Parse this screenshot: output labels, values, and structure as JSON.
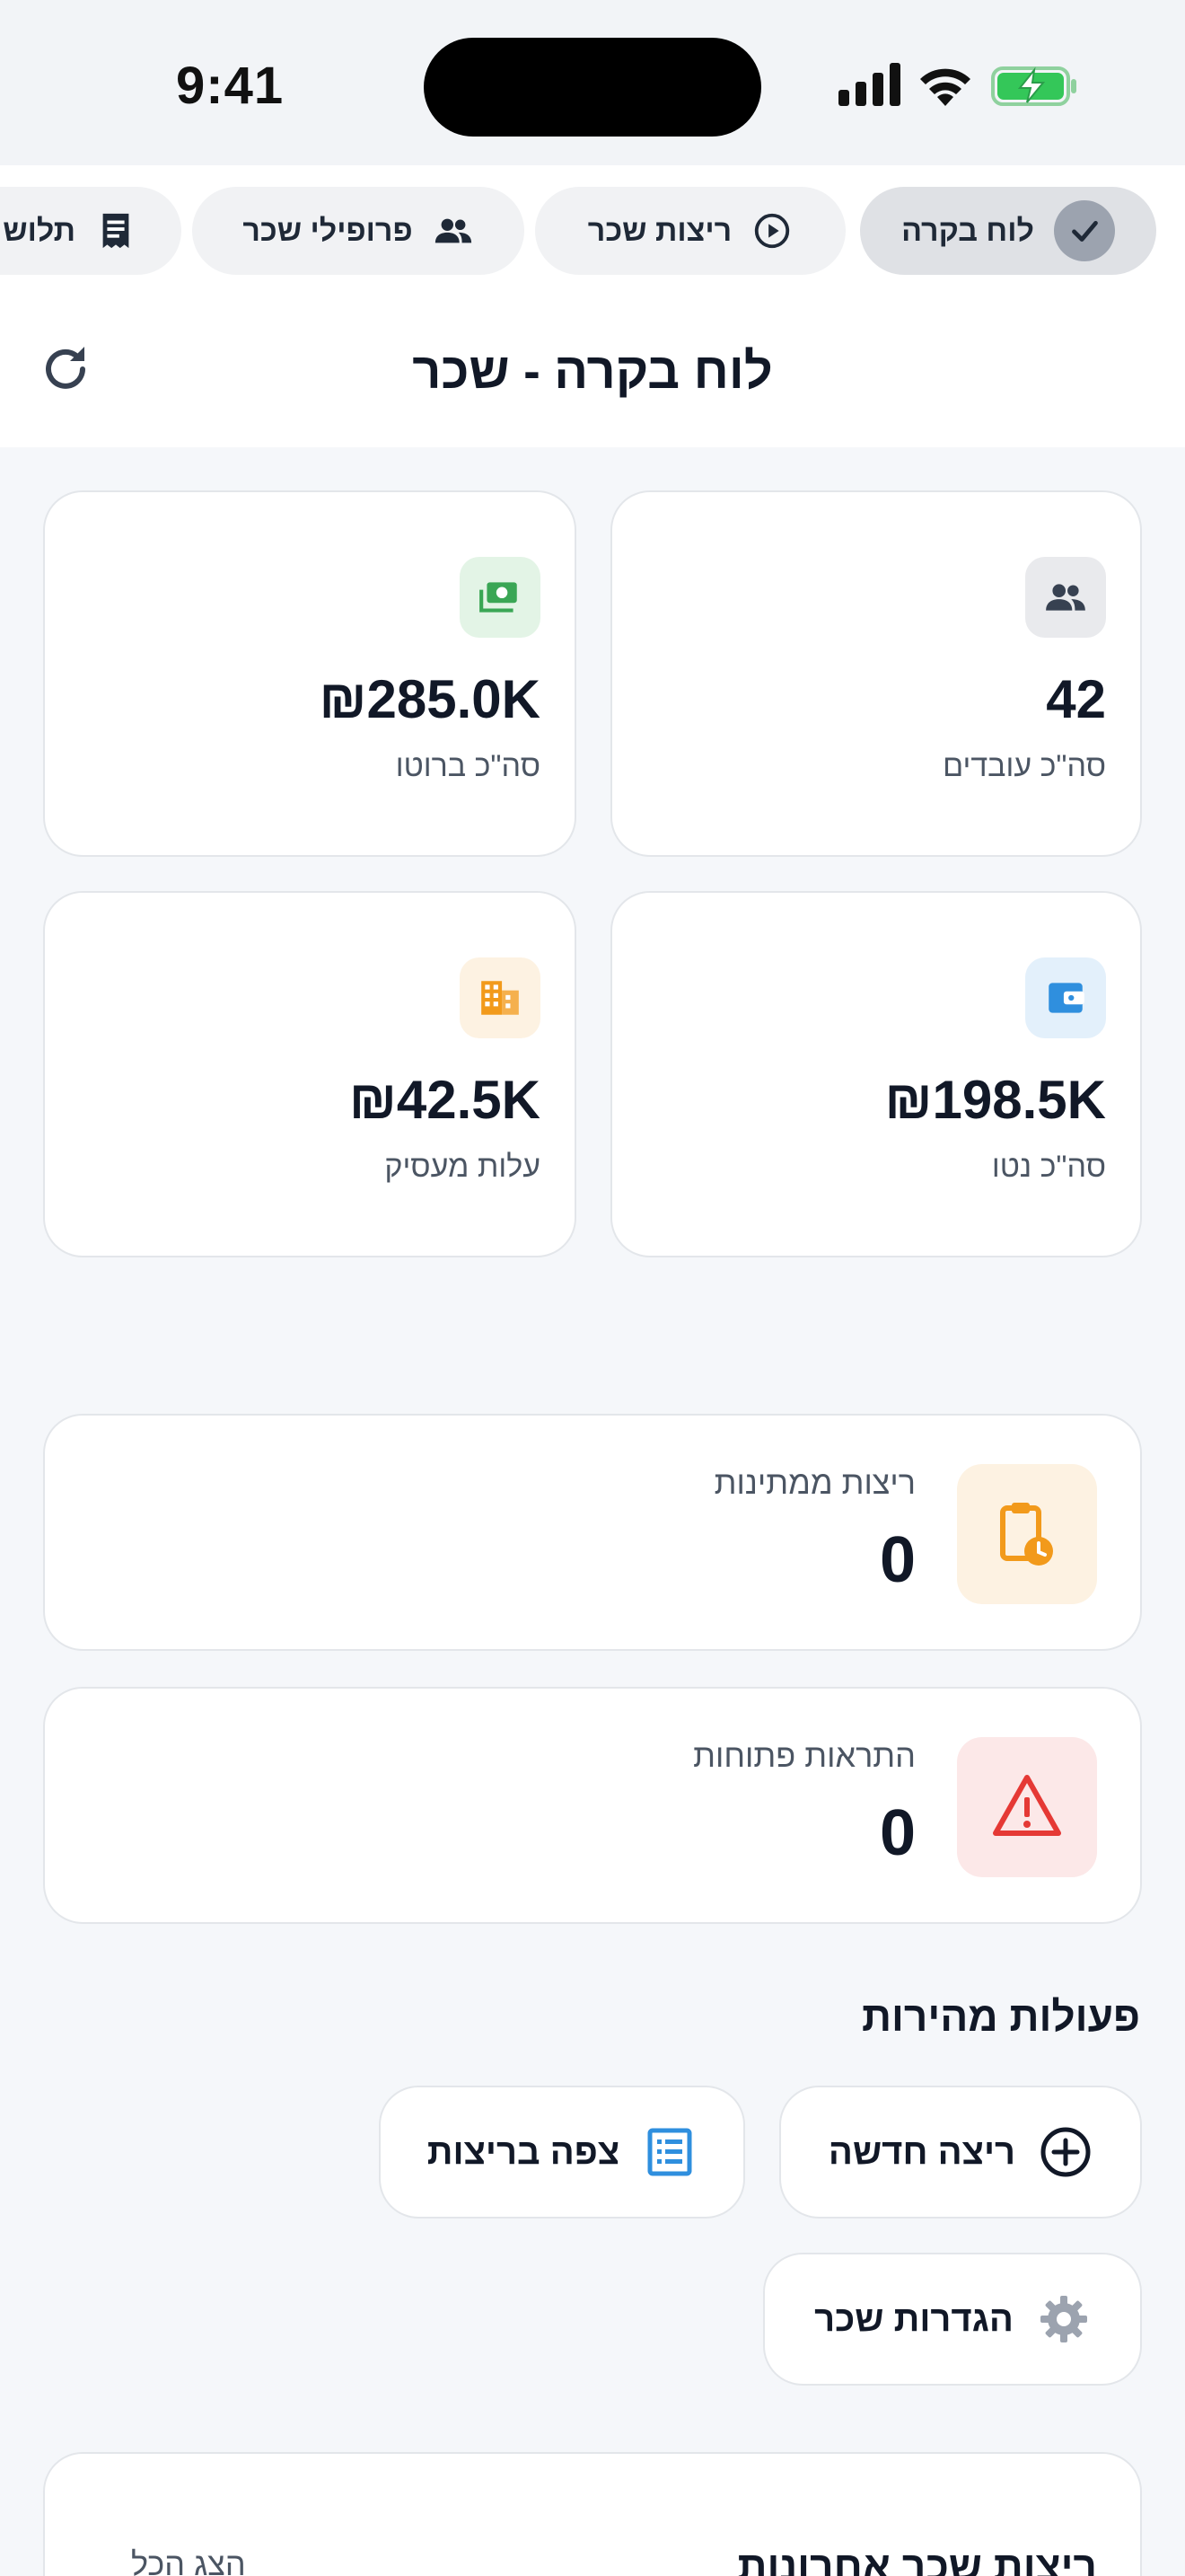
{
  "status_bar": {
    "time": "9:41"
  },
  "tabs": [
    {
      "label": "לוח בקרה",
      "icon": "check-icon",
      "active": true
    },
    {
      "label": "ריצות שכר",
      "icon": "play-circle-icon",
      "active": false
    },
    {
      "label": "פרופילי שכר",
      "icon": "people-icon",
      "active": false
    },
    {
      "label": "תלוש",
      "icon": "receipt-icon",
      "active": false
    }
  ],
  "header": {
    "title": "לוח בקרה - שכר"
  },
  "stats": [
    {
      "value": "42",
      "label": "סה\"כ עובדים",
      "icon": "people-icon",
      "color": "#374151",
      "bg": "#e9eaed"
    },
    {
      "value": "₪285.0K",
      "label": "סה\"כ ברוטו",
      "icon": "money-icon",
      "color": "#3aa655",
      "bg": "#e3f4e6"
    },
    {
      "value": "₪198.5K",
      "label": "סה\"כ נטו",
      "icon": "wallet-icon",
      "color": "#2f8fde",
      "bg": "#e3f0fb"
    },
    {
      "value": "₪42.5K",
      "label": "עלות מעסיק",
      "icon": "building-icon",
      "color": "#f29a1b",
      "bg": "#fdf2e2"
    }
  ],
  "status_cards": [
    {
      "label": "ריצות ממתינות",
      "value": "0",
      "icon": "clipboard-clock-icon",
      "color": "#f29a1b",
      "bg": "#fdf2e2"
    },
    {
      "label": "התראות פתוחות",
      "value": "0",
      "icon": "warning-icon",
      "color": "#e53935",
      "bg": "#fce8e8"
    }
  ],
  "quick_actions": {
    "title": "פעולות מהירות",
    "buttons": [
      {
        "label": "ריצה חדשה",
        "icon": "plus-circle-icon"
      },
      {
        "label": "צפה בריצות",
        "icon": "list-icon"
      },
      {
        "label": "הגדרות שכר",
        "icon": "gear-icon"
      }
    ]
  },
  "recent_runs": {
    "title": "ריצות שכר אחרונות",
    "view_all": "הצג הכל"
  }
}
